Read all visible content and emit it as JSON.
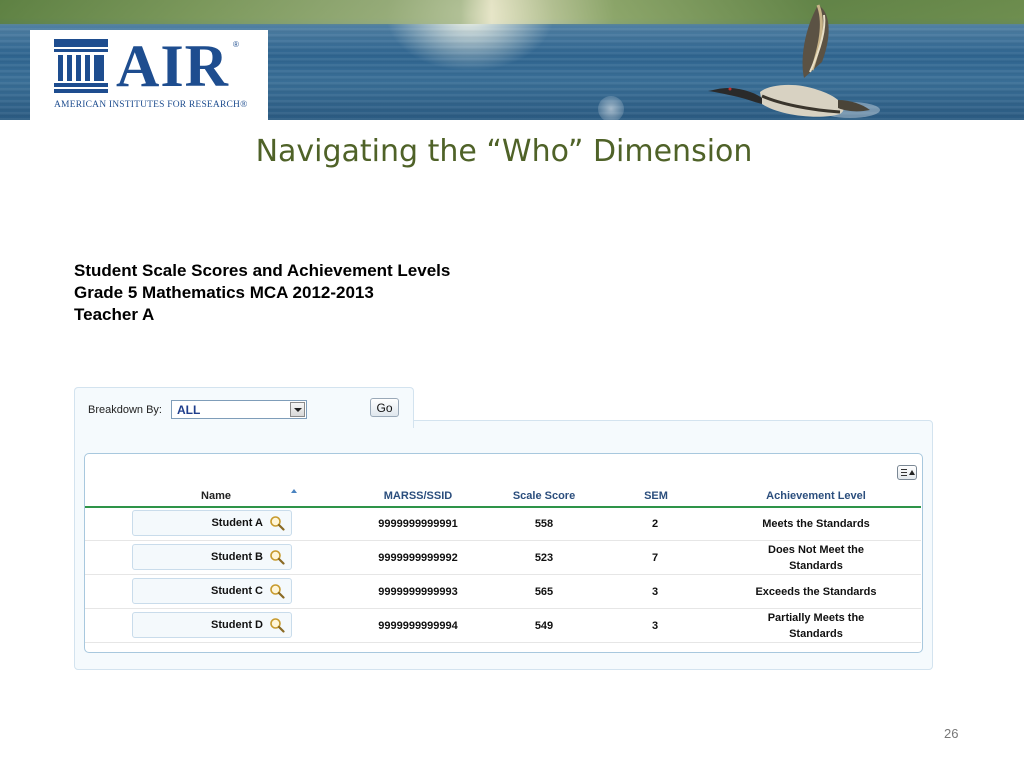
{
  "logo": {
    "word": "AIR",
    "registered": "®",
    "tagline": "American Institutes for Research®"
  },
  "slide_title": "Navigating the “Who” Dimension",
  "report": {
    "title_lines": [
      "Student Scale Scores and Achievement Levels",
      "Grade 5 Mathematics MCA 2012-2013",
      "Teacher A"
    ]
  },
  "filter": {
    "label": "Breakdown By:",
    "selected": "ALL",
    "go_label": "Go"
  },
  "table": {
    "columns": [
      "Name",
      "MARSS/SSID",
      "Scale Score",
      "SEM",
      "Achievement Level"
    ],
    "rows": [
      {
        "name": "Student A",
        "ssid": "9999999999991",
        "score": "558",
        "sem": "2",
        "level": "Meets the Standards"
      },
      {
        "name": "Student B",
        "ssid": "9999999999992",
        "score": "523",
        "sem": "7",
        "level": "Does Not Meet the Standards"
      },
      {
        "name": "Student C",
        "ssid": "9999999999993",
        "score": "565",
        "sem": "3",
        "level": "Exceeds the Standards"
      },
      {
        "name": "Student D",
        "ssid": "9999999999994",
        "score": "549",
        "sem": "3",
        "level": "Partially Meets the Standards"
      }
    ]
  },
  "colors": {
    "title_green": "#4f6228",
    "air_blue": "#1e4d8f",
    "header_line": "#2e9448"
  },
  "page_number": "26"
}
